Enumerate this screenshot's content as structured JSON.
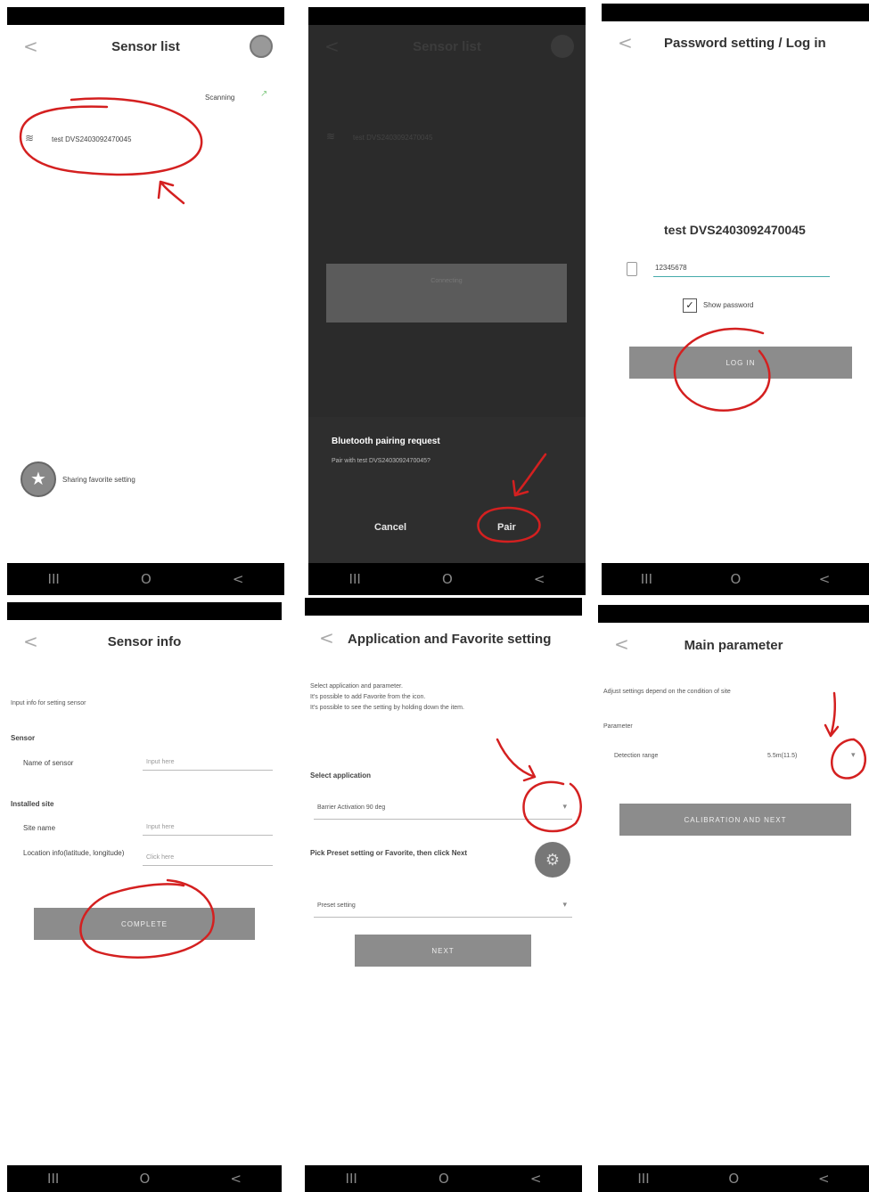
{
  "nav": {
    "recent": "III",
    "home": "O",
    "back": "<"
  },
  "back_glyph": "<",
  "panel1": {
    "title": "Sensor list",
    "scanning": "Scanning",
    "device": "test DVS2403092470045",
    "favorite_label": "Sharing favorite setting"
  },
  "panel2": {
    "title": "Sensor list",
    "device": "test DVS2403092470045",
    "connecting": "Connecting",
    "dialog_title": "Bluetooth pairing request",
    "dialog_body": "Pair with test DVS2403092470045?",
    "cancel": "Cancel",
    "pair": "Pair"
  },
  "panel3": {
    "title": "Password setting / Log in",
    "device": "test DVS2403092470045",
    "password_value": "12345678",
    "show_password": "Show password",
    "login": "LOG IN"
  },
  "panel4": {
    "title": "Sensor info",
    "intro": "Input info for setting sensor",
    "sensor_header": "Sensor",
    "name_label": "Name of sensor",
    "name_placeholder": "Input here",
    "site_header": "Installed site",
    "site_label": "Site name",
    "site_placeholder": "Input here",
    "location_label": "Location info(latitude, longitude)",
    "location_placeholder": "Click here",
    "complete": "COMPLETE"
  },
  "panel5": {
    "title": "Application and Favorite setting",
    "desc1": "Select application and parameter.",
    "desc2": "It's possible to add Favorite from the icon.",
    "desc3": "It's possible to see the setting by holding down the item.",
    "select_app": "Select application",
    "app_value": "Barrier Activation 90 deg",
    "pick_label": "Pick Preset setting or Favorite, then click Next",
    "preset_value": "Preset setting",
    "next": "NEXT"
  },
  "panel6": {
    "title": "Main parameter",
    "desc": "Adjust settings depend on the condition of site",
    "param_header": "Parameter",
    "detection_label": "Detection range",
    "detection_value": "5.5m(11.5)",
    "calibration": "CALIBRATION AND NEXT"
  }
}
